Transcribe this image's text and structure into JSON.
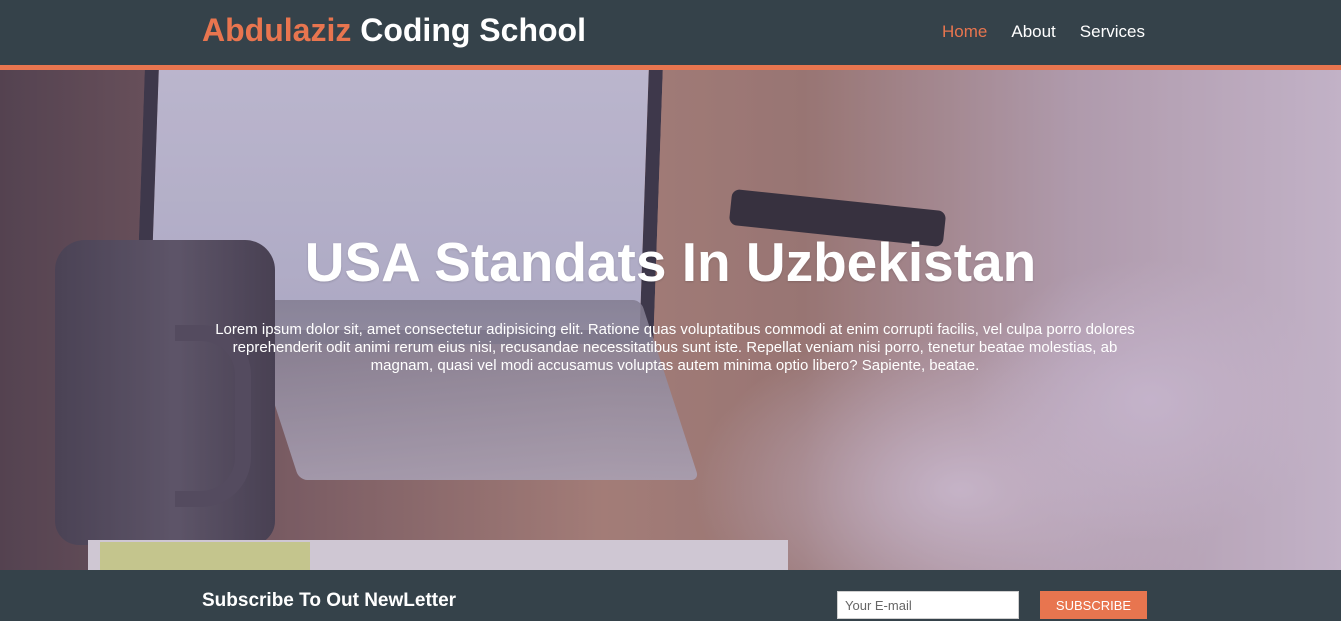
{
  "header": {
    "logo_highlight": "Abdulaziz",
    "logo_rest": " Coding School",
    "nav": [
      {
        "label": "Home",
        "active": true
      },
      {
        "label": "About",
        "active": false
      },
      {
        "label": "Services",
        "active": false
      }
    ]
  },
  "hero": {
    "title": "USA Standats In Uzbekistan",
    "text": "Lorem ipsum dolor sit, amet consectetur adipisicing elit. Ratione quas voluptatibus commodi at enim corrupti facilis, vel culpa porro dolores reprehenderit odit animi rerum eius nisi, recusandae necessitatibus sunt iste. Repellat veniam nisi porro, tenetur beatae molestias, ab magnam, quasi vel modi accusamus voluptas autem minima optio libero? Sapiente, beatae."
  },
  "newsletter": {
    "title": "Subscribe To Out NewLetter",
    "email_placeholder": "Your E-mail",
    "email_value": "",
    "button_label": "SUBSCRIBE"
  },
  "colors": {
    "accent": "#e8754f",
    "dark": "#35424a",
    "text_light": "#ffffff"
  }
}
